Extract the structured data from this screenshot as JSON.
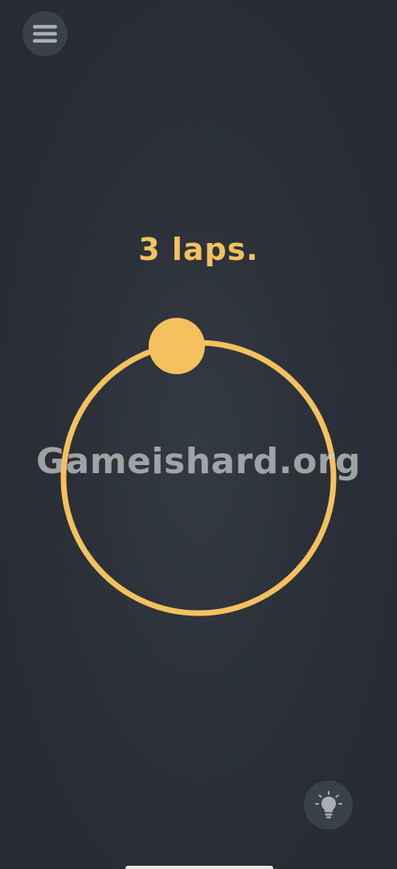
{
  "level": {
    "title": "3 laps."
  },
  "game": {
    "track_color": "#f4c15e",
    "ball_color": "#f4c15e",
    "background_color": "#2b3038"
  },
  "watermark": {
    "text": "Gameishard.org"
  },
  "icons": {
    "menu": "hamburger-menu-icon",
    "hint": "lightbulb-icon"
  }
}
